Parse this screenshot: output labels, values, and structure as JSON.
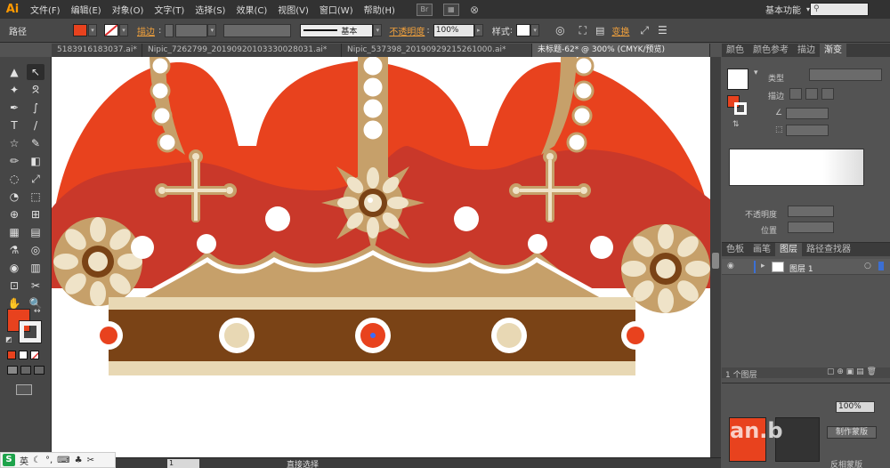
{
  "app": {
    "logo": "Ai"
  },
  "menu": [
    "文件(F)",
    "编辑(E)",
    "对象(O)",
    "文字(T)",
    "选择(S)",
    "效果(C)",
    "视图(V)",
    "窗口(W)",
    "帮助(H)"
  ],
  "menu_icons": {
    "br": "Br"
  },
  "workspace": {
    "label": "基本功能"
  },
  "search": {
    "placeholder": ""
  },
  "control": {
    "path_label": "路径",
    "stroke_label": "描边",
    "stroke_style": "基本",
    "opacity_label": "不透明度",
    "opacity_value": "100%",
    "style_label": "样式",
    "recolor_label": "变换",
    "fill_color": "#e8421e"
  },
  "tabs": [
    {
      "label": "5183916183037.ai*",
      "active": false
    },
    {
      "label": "Nipic_7262799_20190920103330028031.ai*",
      "active": false
    },
    {
      "label": "Nipic_537398_20190929215261000.ai*",
      "active": false
    },
    {
      "label": "未标题-62* @ 300% (CMYK/预览)",
      "active": true
    }
  ],
  "tools": [
    "▲",
    "↖",
    "✦",
    "✒",
    "T",
    "/",
    "▭",
    "✎",
    "◌",
    "⤢",
    "⊕",
    "⊞",
    "▦",
    "▤",
    "⚲",
    "✂",
    "✋",
    "🔍"
  ],
  "panels": {
    "top_tabs": [
      "颜色",
      "颜色参考",
      "描边",
      "渐变"
    ],
    "gradient": {
      "type_label": "类型",
      "stroke_label": "描边",
      "opacity_label": "不透明度",
      "position_label": "位置"
    },
    "layers_tabs": [
      "色板",
      "画笔",
      "图层",
      "路径查找器"
    ],
    "layer_name": "图层 1",
    "layer_count": "1 个图层",
    "bottom_value": "100%",
    "bottom_button": "制作蒙版",
    "bottom_label": "反相蒙版"
  },
  "status": {
    "zoom": "1",
    "tool_label": "直接选择"
  },
  "ime": {
    "lang": "英"
  },
  "watermark": "an.b",
  "colors": {
    "crown_red": "#e8421e",
    "crown_dark_red": "#c9382a",
    "gold": "#c6a06a",
    "cream": "#efe3c8",
    "brown": "#7a4316",
    "pearl": "#ffffff"
  }
}
